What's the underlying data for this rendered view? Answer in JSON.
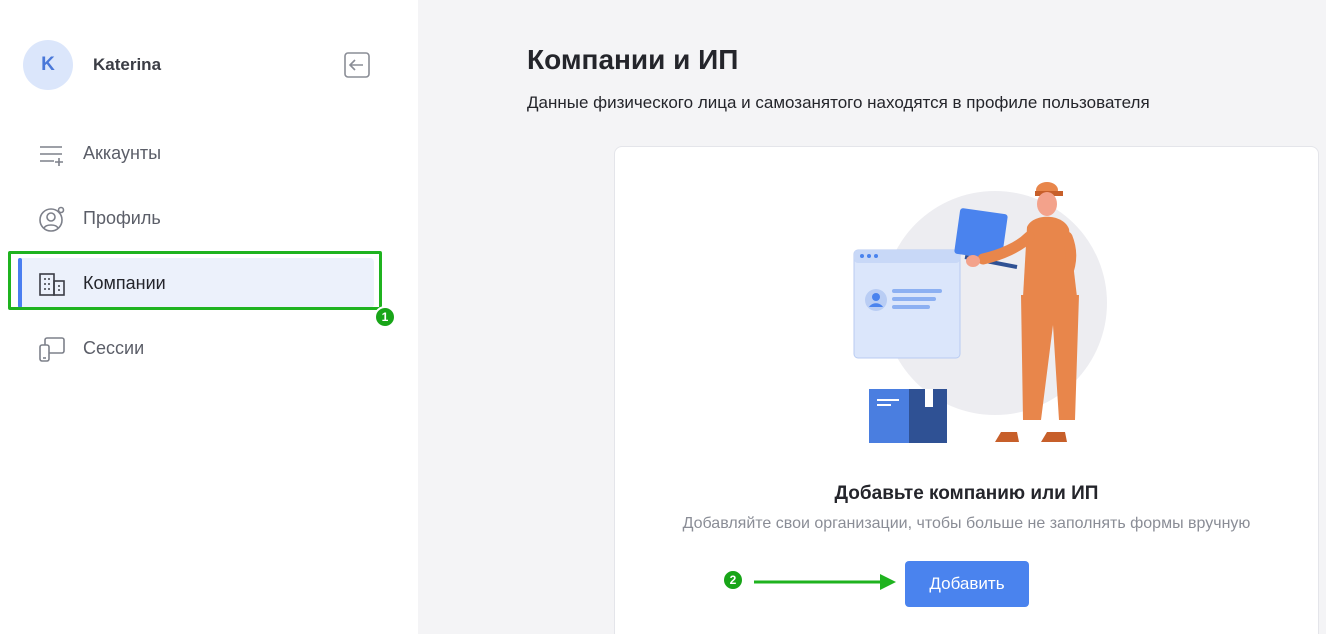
{
  "user": {
    "initial": "K",
    "name": "Katerina"
  },
  "sidebar": {
    "items": [
      {
        "label": "Аккаунты",
        "icon": "accounts-list-icon",
        "active": false
      },
      {
        "label": "Профиль",
        "icon": "profile-settings-icon",
        "active": false
      },
      {
        "label": "Компании",
        "icon": "building-icon",
        "active": true
      },
      {
        "label": "Сессии",
        "icon": "devices-icon",
        "active": false
      }
    ]
  },
  "main": {
    "title": "Компании и ИП",
    "subtitle": "Данные физического лица и самозанятого находятся в профиле пользователя",
    "empty_state": {
      "title": "Добавьте компанию или ИП",
      "description": "Добавляйте свои организации, чтобы больше не заполнять формы вручную",
      "button_label": "Добавить"
    }
  },
  "annotations": {
    "marker_1": "1",
    "marker_2": "2"
  },
  "colors": {
    "accent": "#4a83ee",
    "highlight": "#1fb31f",
    "active_bg": "#ecf1fb"
  }
}
